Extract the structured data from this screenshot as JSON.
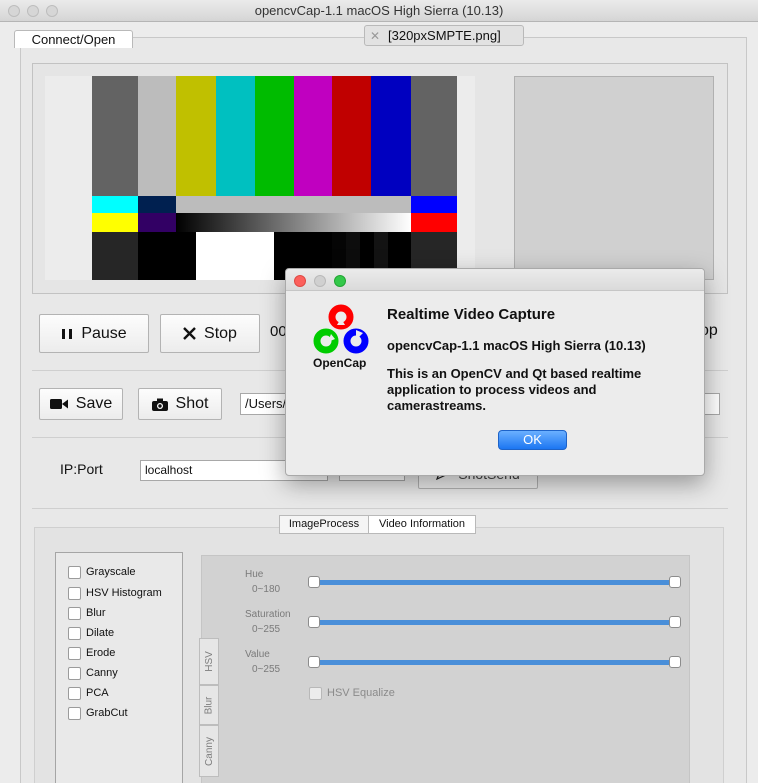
{
  "window": {
    "title": "opencvCap-1.1  macOS High Sierra (10.13)"
  },
  "tabs": {
    "connect_label": "Connect/Open",
    "file_label": "[320pxSMPTE.png]"
  },
  "controls": {
    "pause_label": "Pause",
    "stop_label": "Stop",
    "timestamp_partial": "00",
    "stop2_partial": "op",
    "save_label": "Save",
    "shot_label": "Shot",
    "path_value": "/Users/",
    "ip_port_label": "IP:Port",
    "host_value": "localhost",
    "shotsend_partial": "ShotSend"
  },
  "lower_tabs": [
    "ImageProcess",
    "Video Information"
  ],
  "image_process": {
    "checkboxes": [
      "Grayscale",
      "HSV Histogram",
      "Blur",
      "Dilate",
      "Erode",
      "Canny",
      "PCA",
      "GrabCut"
    ],
    "side_tabs": [
      "HSV",
      "Blur",
      "Canny"
    ],
    "sliders": [
      {
        "name": "Hue",
        "range": "0~180",
        "low": 0,
        "high": 180
      },
      {
        "name": "Saturation",
        "range": "0~255",
        "low": 0,
        "high": 255
      },
      {
        "name": "Value",
        "range": "0~255",
        "low": 0,
        "high": 255
      }
    ],
    "hsv_equalize_label": "HSV Equalize"
  },
  "dialog": {
    "logo_text": "OpenCap",
    "title": "Realtime Video Capture",
    "subtitle": "opencvCap-1.1 macOS High Sierra (10.13)",
    "body": "This is an OpenCV and Qt based realtime application to process videos and camerastreams.",
    "ok_label": "OK"
  },
  "colors": {
    "accent": "#1c76f2",
    "slider_track": "#4a8fd9",
    "traffic_close": "#fc605c",
    "traffic_min": "#fdbc40",
    "traffic_max": "#34c84a",
    "logo_red": "#ff0000",
    "logo_green": "#00cc00",
    "logo_blue": "#0000ff"
  },
  "icons": {
    "pause": "pause-icon",
    "stop": "close-x-icon",
    "save": "video-camera-icon",
    "shot": "photo-camera-icon",
    "send": "paper-plane-icon"
  }
}
